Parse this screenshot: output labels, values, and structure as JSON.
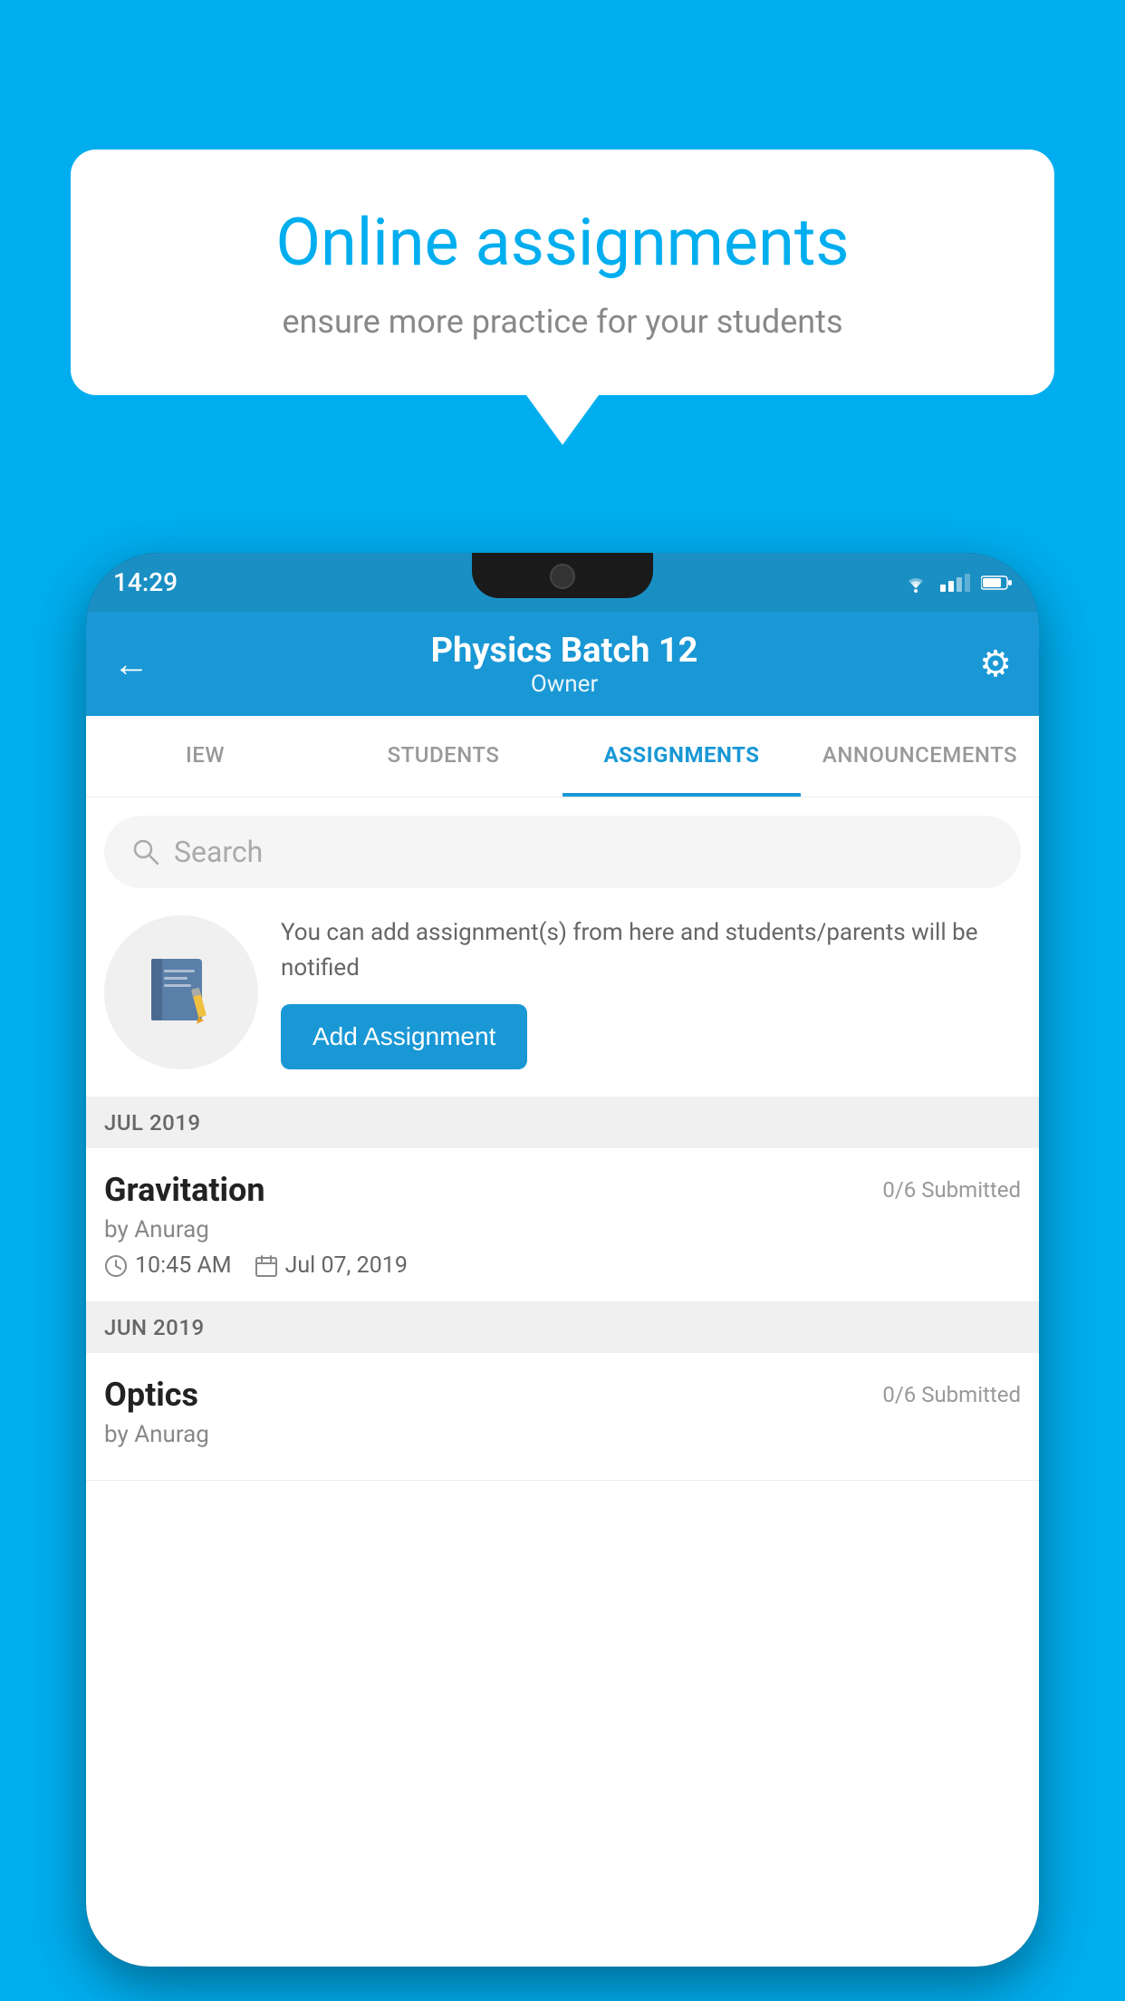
{
  "background": {
    "color": "#00AEEF"
  },
  "speech_bubble": {
    "title": "Online assignments",
    "subtitle": "ensure more practice for your students"
  },
  "status_bar": {
    "time": "14:29"
  },
  "app_header": {
    "title": "Physics Batch 12",
    "subtitle": "Owner",
    "back_label": "←",
    "settings_label": "⚙"
  },
  "tabs": [
    {
      "label": "IEW",
      "active": false
    },
    {
      "label": "STUDENTS",
      "active": false
    },
    {
      "label": "ASSIGNMENTS",
      "active": true
    },
    {
      "label": "ANNOUNCEMENTS",
      "active": false
    }
  ],
  "search": {
    "placeholder": "Search"
  },
  "promo": {
    "text": "You can add assignment(s) from here and students/parents will be notified",
    "button_label": "Add Assignment"
  },
  "sections": [
    {
      "header": "JUL 2019",
      "assignments": [
        {
          "name": "Gravitation",
          "submitted": "0/6 Submitted",
          "author": "by Anurag",
          "time": "10:45 AM",
          "date": "Jul 07, 2019"
        }
      ]
    },
    {
      "header": "JUN 2019",
      "assignments": [
        {
          "name": "Optics",
          "submitted": "0/6 Submitted",
          "author": "by Anurag",
          "time": "",
          "date": ""
        }
      ]
    }
  ]
}
